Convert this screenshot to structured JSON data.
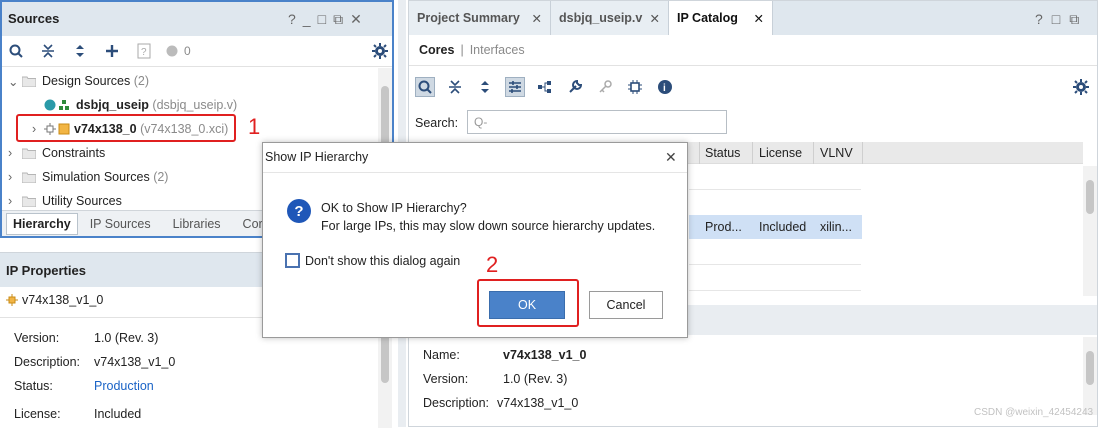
{
  "sources": {
    "title": "Sources",
    "count": "0",
    "tree": [
      {
        "label": "Design Sources",
        "count": "(2)"
      },
      {
        "label": "dsbjq_useip",
        "sub": "(dsbjq_useip.v)"
      },
      {
        "label": "v74x138_0",
        "sub": "(v74x138_0.xci)"
      },
      {
        "label": "Constraints"
      },
      {
        "label": "Simulation Sources",
        "count": "(2)"
      },
      {
        "label": "Utility Sources"
      }
    ],
    "tabs": [
      "Hierarchy",
      "IP Sources",
      "Libraries",
      "Cor"
    ],
    "win_controls": [
      "?",
      "_",
      "□",
      "⧉",
      "✕"
    ]
  },
  "ip_properties": {
    "title": "IP Properties",
    "item": "v74x138_v1_0",
    "rows": [
      {
        "key": "Version:",
        "value": "1.0 (Rev. 3)"
      },
      {
        "key": "Description:",
        "value": "v74x138_v1_0"
      },
      {
        "key": "Status:",
        "value": "Production"
      },
      {
        "key": "License:",
        "value": "Included"
      }
    ]
  },
  "right_panel": {
    "tabs": [
      "Project Summary",
      "dsbjq_useip.v",
      "IP Catalog"
    ],
    "subtabs": [
      "Cores",
      "Interfaces"
    ],
    "subtab_sep": "|",
    "search_label": "Search:",
    "search_placeholder": "Q-",
    "columns": [
      "Status",
      "License",
      "VLNV"
    ],
    "row": {
      "status": "Prod...",
      "license": "Included",
      "vlnv": "xilin..."
    },
    "details": [
      {
        "key": "Name:",
        "value": "v74x138_v1_0"
      },
      {
        "key": "Version:",
        "value": "1.0 (Rev. 3)"
      },
      {
        "key": "Description:",
        "value": "v74x138_v1_0"
      }
    ]
  },
  "dialog": {
    "title": "Show IP Hierarchy",
    "line1": "OK to Show IP Hierarchy?",
    "line2": "For large IPs, this may slow down source hierarchy updates.",
    "checkbox": "Don't show this dialog again",
    "ok": "OK",
    "cancel": "Cancel",
    "close": "✕"
  },
  "annotations": {
    "one": "1",
    "two": "2"
  },
  "watermark": "CSDN @weixin_42454243",
  "colors": {
    "accent": "#3b6fbf",
    "ok_button": "#4a82c9",
    "highlight": "#e02020",
    "link": "#1a63c6"
  }
}
